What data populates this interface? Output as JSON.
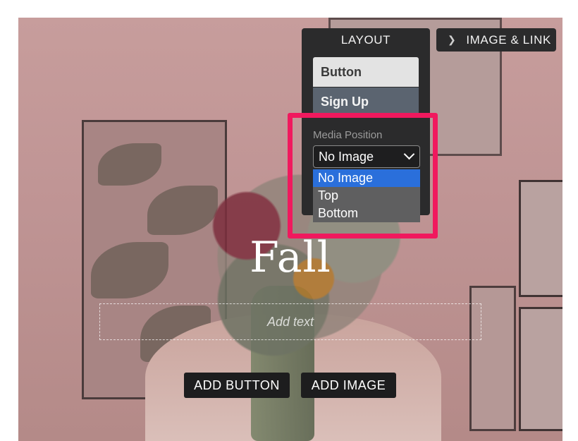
{
  "colors": {
    "accent_highlight": "#f0195e",
    "panel_bg": "#2b2b2c",
    "selected_option": "#2a6fdb"
  },
  "panel": {
    "header": "LAYOUT",
    "styles": [
      {
        "label": "Button"
      },
      {
        "label": "Sign Up"
      }
    ],
    "image_link_tab": "IMAGE & LINK",
    "chevron_icon": "chevron-right-icon"
  },
  "media_position": {
    "label": "Media Position",
    "selected": "No Image",
    "options": [
      "No Image",
      "Top",
      "Bottom"
    ]
  },
  "canvas": {
    "title": "Fall",
    "text_placeholder": "Add text",
    "add_button": "ADD BUTTON",
    "add_image": "ADD IMAGE"
  }
}
